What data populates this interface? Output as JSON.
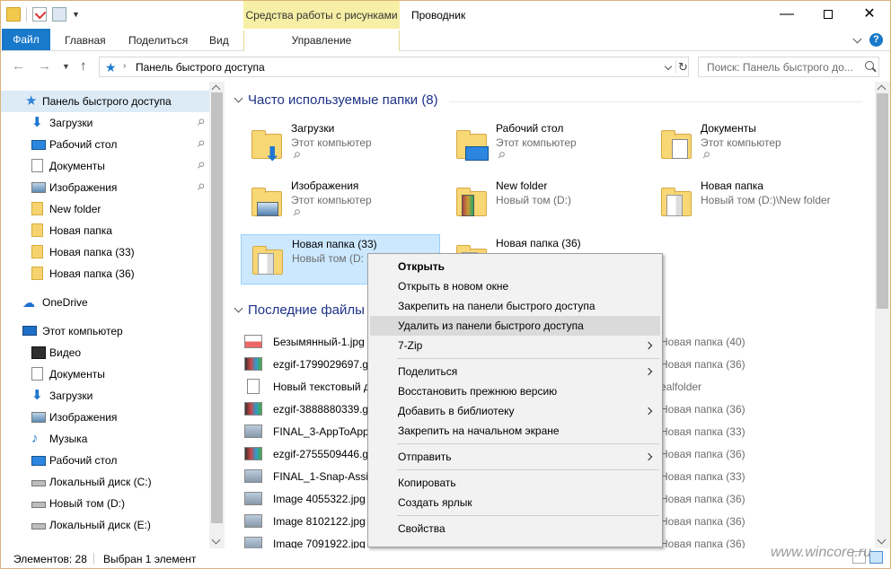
{
  "window": {
    "title": "Проводник",
    "context_tab_header": "Средства работы с рисунками",
    "minimize": "—",
    "maximize": "",
    "close": "✕"
  },
  "ribbon": {
    "tabs": [
      "Файл",
      "Главная",
      "Поделиться",
      "Вид"
    ],
    "context_tab": "Управление",
    "help": "?"
  },
  "address": {
    "path": "Панель быстрого доступа",
    "search_placeholder": "Поиск: Панель быстрого до..."
  },
  "nav": {
    "quick_access": "Панель быстрого доступа",
    "pinned": [
      {
        "label": "Загрузки",
        "icon": "download-icon",
        "pinned": true
      },
      {
        "label": "Рабочий стол",
        "icon": "desktop-icon",
        "pinned": true
      },
      {
        "label": "Документы",
        "icon": "documents-icon",
        "pinned": true
      },
      {
        "label": "Изображения",
        "icon": "pictures-icon",
        "pinned": true
      },
      {
        "label": "New folder",
        "icon": "folder-icon",
        "pinned": false
      },
      {
        "label": "Новая папка",
        "icon": "folder-icon",
        "pinned": false
      },
      {
        "label": "Новая папка (33)",
        "icon": "folder-icon",
        "pinned": false
      },
      {
        "label": "Новая папка (36)",
        "icon": "folder-icon",
        "pinned": false
      }
    ],
    "onedrive": "OneDrive",
    "this_pc": "Этот компьютер",
    "pc_items": [
      {
        "label": "Видео",
        "icon": "video-icon"
      },
      {
        "label": "Документы",
        "icon": "documents-icon"
      },
      {
        "label": "Загрузки",
        "icon": "download-icon"
      },
      {
        "label": "Изображения",
        "icon": "pictures-icon"
      },
      {
        "label": "Музыка",
        "icon": "music-icon"
      },
      {
        "label": "Рабочий стол",
        "icon": "desktop-icon"
      },
      {
        "label": "Локальный диск (C:)",
        "icon": "drive-icon"
      },
      {
        "label": "Новый том (D:)",
        "icon": "drive-icon"
      },
      {
        "label": "Локальный диск (E:)",
        "icon": "drive-icon"
      }
    ]
  },
  "frequent": {
    "header": "Часто используемые папки (8)",
    "folders": [
      {
        "name": "Загрузки",
        "sub": "Этот компьютер",
        "pinned": true,
        "icon": "downloads-folder-icon"
      },
      {
        "name": "Рабочий стол",
        "sub": "Этот компьютер",
        "pinned": true,
        "icon": "desktop-folder-icon"
      },
      {
        "name": "Документы",
        "sub": "Этот компьютер",
        "pinned": true,
        "icon": "documents-folder-icon"
      },
      {
        "name": "Изображения",
        "sub": "Этот компьютер",
        "pinned": true,
        "icon": "pictures-folder-icon"
      },
      {
        "name": "New folder",
        "sub": "Новый том (D:)",
        "pinned": false,
        "icon": "folder-icon"
      },
      {
        "name": "Новая папка",
        "sub": "Новый том (D:)\\New folder",
        "pinned": false,
        "icon": "folder-icon"
      },
      {
        "name": "Новая папка (33)",
        "sub": "Новый том (D:",
        "pinned": false,
        "icon": "folder-icon"
      },
      {
        "name": "Новая папка (36)",
        "sub": "",
        "pinned": false,
        "icon": "folder-icon"
      }
    ]
  },
  "recent": {
    "header": "Последние файлы",
    "files": [
      {
        "name": "Безымянный-1.jpg",
        "loc": "Новая папка (40)",
        "icon": "image-file-icon"
      },
      {
        "name": "ezgif-1799029697.gif",
        "loc": "Новая папка (36)",
        "icon": "gif-file-icon"
      },
      {
        "name": "Новый текстовый д",
        "loc": "ealfolder",
        "icon": "text-file-icon"
      },
      {
        "name": "ezgif-3888880339.gif",
        "loc": "Новая папка (36)",
        "icon": "gif-file-icon"
      },
      {
        "name": "FINAL_3-AppToApp",
        "loc": "Новая папка (33)",
        "icon": "image-file-icon"
      },
      {
        "name": "ezgif-2755509446.gif",
        "loc": "Новая папка (36)",
        "icon": "gif-file-icon"
      },
      {
        "name": "FINAL_1-Snap-Assis",
        "loc": "Новая папка (33)",
        "icon": "image-file-icon"
      },
      {
        "name": "Image 4055322.jpg",
        "loc": "Новая папка (36)",
        "icon": "image-file-icon"
      },
      {
        "name": "Image 8102122.jpg",
        "loc": "Новая папка (36)",
        "icon": "image-file-icon"
      },
      {
        "name": "Image 7091922.jpg",
        "loc": "Новая папка (36)",
        "icon": "image-file-icon"
      }
    ]
  },
  "context_menu": {
    "items": [
      {
        "label": "Открыть",
        "bold": true
      },
      {
        "label": "Открыть в новом окне"
      },
      {
        "label": "Закрепить на панели быстрого доступа"
      },
      {
        "label": "Удалить из панели быстрого доступа",
        "highlighted": true
      },
      {
        "label": "7-Zip",
        "submenu": true
      },
      {
        "label": "Поделиться",
        "submenu": true
      },
      {
        "label": "Восстановить прежнюю версию"
      },
      {
        "label": "Добавить в библиотеку",
        "submenu": true
      },
      {
        "label": "Закрепить на начальном экране"
      },
      {
        "label": "Отправить",
        "submenu": true
      },
      {
        "label": "Копировать"
      },
      {
        "label": "Создать ярлык"
      },
      {
        "label": "Свойства"
      }
    ]
  },
  "status": {
    "count": "Элементов: 28",
    "selected": "Выбран 1 элемент"
  },
  "watermark": "www.wincore.ru",
  "colors": {
    "accent": "#1979ca",
    "context_tab": "#f7efa5",
    "selection": "#cce8ff",
    "nav_selected": "#ddebf7"
  }
}
